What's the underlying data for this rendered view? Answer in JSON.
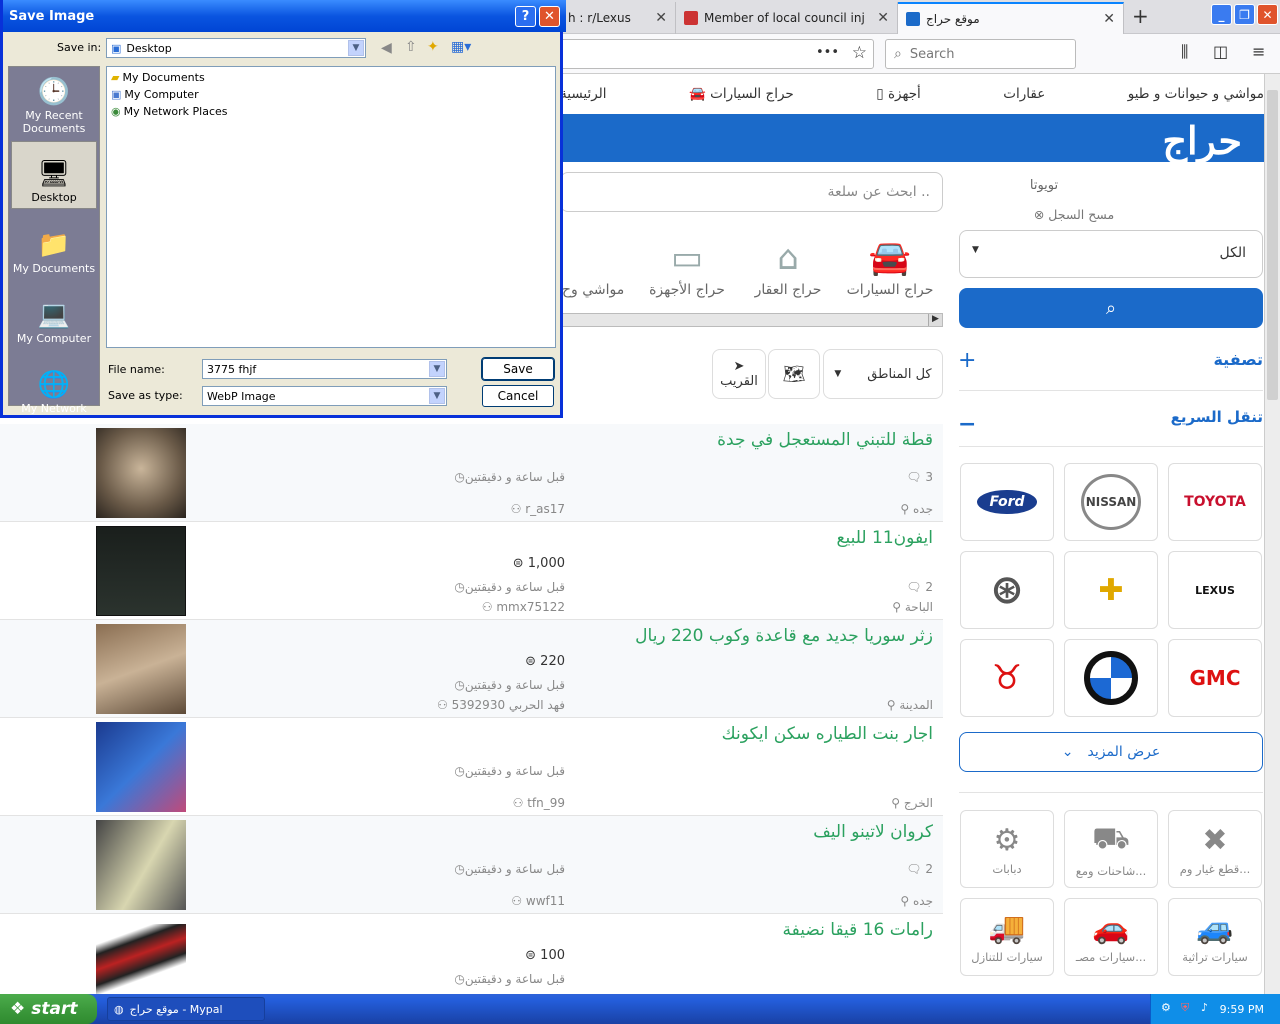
{
  "browser": {
    "tabs": [
      {
        "label": "h : r/Lexus"
      },
      {
        "label": "Member of local council injured in"
      },
      {
        "label": "موقع حراج"
      }
    ],
    "search_placeholder": "Search",
    "url_dots": "•••"
  },
  "site": {
    "nav": [
      "الرئيسية",
      "حراج السيارات",
      "أجهزة",
      "عقارات",
      "مواشي و حيوانات و طيو"
    ],
    "logo": "حراج",
    "sidebar": {
      "recent_search": "تويوتا",
      "clear_history": "مسح السجل",
      "dropdown_value": "الكل",
      "filter_label": "تصفية",
      "quick_nav_label": "تنقل السريع",
      "brands": [
        "TOYOTA",
        "NISSAN",
        "Ford",
        "LEXUS",
        "CHEVROLET",
        "MERCEDES",
        "GMC",
        "BMW",
        "RAM"
      ],
      "show_more": "عرض المزيد",
      "categories": [
        "قطع غيار وم...",
        "شاحنات ومع...",
        "دبابات",
        "سيارات تراثية",
        "سيارات مصـ...",
        "سيارات للتنازل"
      ]
    },
    "search_placeholder": "ابحث عن سلعة ..",
    "categories": [
      "حراج السيارات",
      "حراج العقار",
      "حراج الأجهزة",
      "مواشي وح"
    ],
    "region_select": "كل المناطق",
    "nearby_label": "القريب",
    "listings": [
      {
        "title": "قطة للتبني المستعجل في جدة",
        "comments": "3",
        "time": "قبل ساعة و دقيقتين",
        "user": "r_as17",
        "city": "جده",
        "price": ""
      },
      {
        "title": "ايفون11 للبيع",
        "comments": "2",
        "time": "قبل ساعة و دقيقتين",
        "user": "mmx75122",
        "city": "الباحة",
        "price": "1,000"
      },
      {
        "title": "زثر سوريا جديد مع قاعدة وكوب 220 ريال",
        "comments": "",
        "time": "قبل ساعة و دقيقتين",
        "user": "فهد الحربي 5392930",
        "city": "المدينة",
        "price": "220"
      },
      {
        "title": "اجار بنت الطياره سكن ايكونك",
        "comments": "",
        "time": "قبل ساعة و دقيقتين",
        "user": "tfn_99",
        "city": "الخرج",
        "price": ""
      },
      {
        "title": "كروان لاتينو اليف",
        "comments": "2",
        "time": "قبل ساعة و دقيقتين",
        "user": "wwf11",
        "city": "جده",
        "price": ""
      },
      {
        "title": "رامات 16 قيقا نضيفة",
        "comments": "",
        "time": "قبل ساعة و دقيقتين",
        "user": "",
        "city": "",
        "price": "100"
      }
    ]
  },
  "dialog": {
    "title": "Save Image",
    "save_in_label": "Save in:",
    "save_in_value": "Desktop",
    "places": [
      "My Recent Documents",
      "Desktop",
      "My Documents",
      "My Computer",
      "My Network"
    ],
    "files": [
      "My Documents",
      "My Computer",
      "My Network Places"
    ],
    "file_name_label": "File name:",
    "file_name_value": "3775 fhjf",
    "save_type_label": "Save as type:",
    "save_type_value": "WebP Image",
    "save_button": "Save",
    "cancel_button": "Cancel",
    "help": "?",
    "close": "✕"
  },
  "taskbar": {
    "start": "start",
    "task": "موقع حراج - Mypal",
    "clock": "9:59 PM"
  },
  "colors": {
    "accent": "#1b6ac9",
    "title_green": "#2ba15f",
    "xp_blue": "#0a55e0"
  }
}
